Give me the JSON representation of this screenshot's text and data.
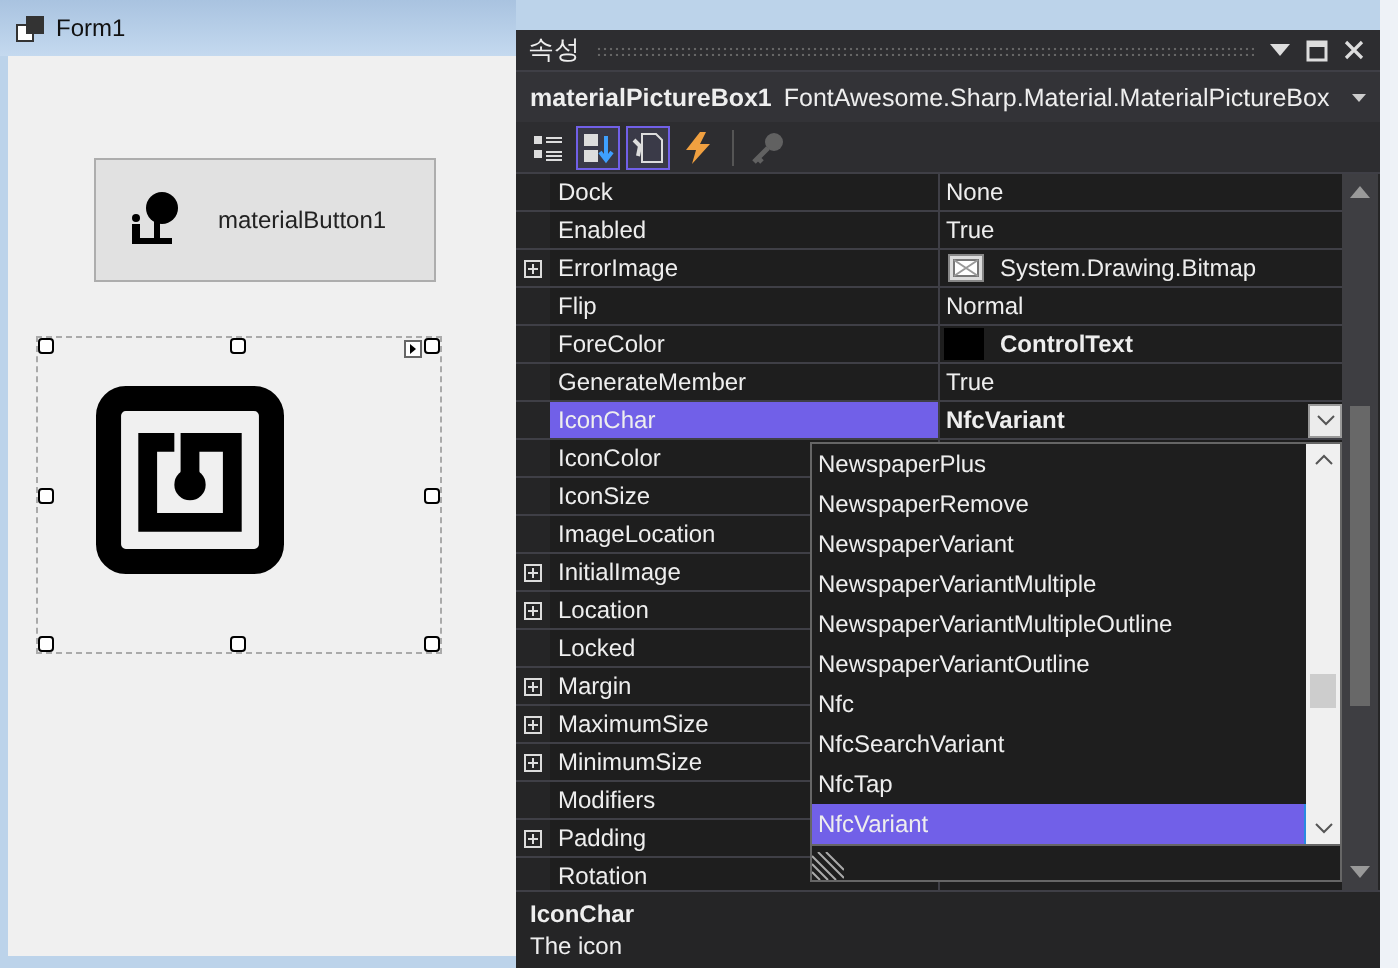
{
  "form": {
    "title": "Form1",
    "button": {
      "label": "materialButton1"
    },
    "picture_box": {
      "selected": true
    }
  },
  "properties": {
    "title": "속성",
    "object_name": "materialPictureBox1",
    "object_type": "FontAwesome.Sharp.Material.MaterialPictureBox",
    "toolbar": [
      {
        "kind": "categorized",
        "selected": false,
        "disabled": false
      },
      {
        "kind": "alphabetical",
        "selected": true,
        "disabled": false
      },
      {
        "kind": "properties",
        "selected": true,
        "disabled": false
      },
      {
        "kind": "events",
        "selected": false,
        "disabled": false
      },
      {
        "kind": "pages",
        "selected": false,
        "disabled": true
      }
    ],
    "rows": [
      {
        "name": "Dock",
        "value": "None",
        "kind": "text",
        "expandable": false,
        "bold": false,
        "selected": false
      },
      {
        "name": "Enabled",
        "value": "True",
        "kind": "text",
        "expandable": false,
        "bold": false,
        "selected": false
      },
      {
        "name": "ErrorImage",
        "value": "System.Drawing.Bitmap",
        "kind": "image",
        "expandable": true,
        "bold": false,
        "selected": false
      },
      {
        "name": "Flip",
        "value": "Normal",
        "kind": "text",
        "expandable": false,
        "bold": false,
        "selected": false
      },
      {
        "name": "ForeColor",
        "value": "ControlText",
        "kind": "color",
        "color": "#000000",
        "expandable": false,
        "bold": true,
        "selected": false
      },
      {
        "name": "GenerateMember",
        "value": "True",
        "kind": "text",
        "expandable": false,
        "bold": false,
        "selected": false
      },
      {
        "name": "IconChar",
        "value": "NfcVariant",
        "kind": "dropdown",
        "expandable": false,
        "bold": true,
        "selected": true
      },
      {
        "name": "IconColor",
        "expandable": false,
        "selected": false
      },
      {
        "name": "IconSize",
        "expandable": false,
        "selected": false
      },
      {
        "name": "ImageLocation",
        "expandable": false,
        "selected": false
      },
      {
        "name": "InitialImage",
        "expandable": true,
        "selected": false
      },
      {
        "name": "Location",
        "expandable": true,
        "selected": false
      },
      {
        "name": "Locked",
        "expandable": false,
        "selected": false
      },
      {
        "name": "Margin",
        "expandable": true,
        "selected": false
      },
      {
        "name": "MaximumSize",
        "expandable": true,
        "selected": false
      },
      {
        "name": "MinimumSize",
        "expandable": true,
        "selected": false
      },
      {
        "name": "Modifiers",
        "expandable": false,
        "selected": false
      },
      {
        "name": "Padding",
        "expandable": true,
        "selected": false
      },
      {
        "name": "Rotation",
        "expandable": false,
        "selected": false
      }
    ],
    "dropdown": {
      "items": [
        {
          "label": "NewspaperPlus",
          "selected": false
        },
        {
          "label": "NewspaperRemove",
          "selected": false
        },
        {
          "label": "NewspaperVariant",
          "selected": false
        },
        {
          "label": "NewspaperVariantMultiple",
          "selected": false
        },
        {
          "label": "NewspaperVariantMultipleOutline",
          "selected": false
        },
        {
          "label": "NewspaperVariantOutline",
          "selected": false
        },
        {
          "label": "Nfc",
          "selected": false
        },
        {
          "label": "NfcSearchVariant",
          "selected": false
        },
        {
          "label": "NfcTap",
          "selected": false
        },
        {
          "label": "NfcVariant",
          "selected": true
        }
      ]
    },
    "description": {
      "title": "IconChar",
      "text": "The icon"
    }
  }
}
